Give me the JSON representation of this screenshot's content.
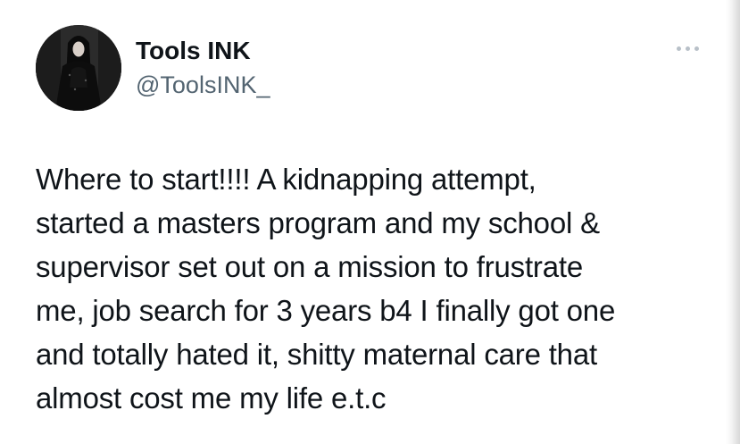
{
  "author": {
    "display_name": "Tools INK",
    "handle": "@ToolsINK_",
    "avatar_icon": "profile-photo"
  },
  "actions": {
    "more_icon": "more-horizontal-icon"
  },
  "tweet": {
    "lines": [
      "Where to start!!!! A kidnapping attempt,",
      "started a masters program and my school &",
      "supervisor set out on a mission to frustrate",
      "me, job search for 3 years b4 I finally got one",
      "and totally hated it, shitty maternal care that",
      "almost cost me my life e.t.c"
    ]
  },
  "colors": {
    "text_primary": "#0f1419",
    "text_secondary": "#536471",
    "more_dots": "#b8c0c8",
    "background": "#ffffff"
  }
}
